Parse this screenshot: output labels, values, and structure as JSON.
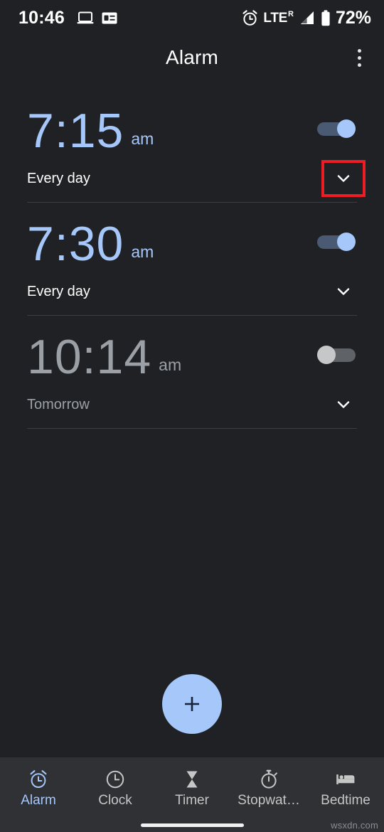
{
  "status_bar": {
    "time": "10:46",
    "left_icons": [
      "laptop-icon",
      "card-icon"
    ],
    "alarm_icon": "alarm-clock-icon",
    "network_type": "LTE",
    "network_superscript": "R",
    "signal_icon": "signal-bars-icon",
    "battery_icon": "battery-icon",
    "battery_percent": "72%"
  },
  "app_bar": {
    "title": "Alarm",
    "overflow_menu": "more-options"
  },
  "alarms": [
    {
      "time": "7:15",
      "ampm": "am",
      "schedule": "Every day",
      "enabled": true,
      "highlighted": true
    },
    {
      "time": "7:30",
      "ampm": "am",
      "schedule": "Every day",
      "enabled": true,
      "highlighted": false
    },
    {
      "time": "10:14",
      "ampm": "am",
      "schedule": "Tomorrow",
      "enabled": false,
      "highlighted": false
    }
  ],
  "fab": {
    "label": "+",
    "name": "add-alarm-button"
  },
  "bottom_nav": {
    "items": [
      {
        "label": "Alarm",
        "icon": "alarm-clock-icon",
        "active": true
      },
      {
        "label": "Clock",
        "icon": "clock-icon",
        "active": false
      },
      {
        "label": "Timer",
        "icon": "hourglass-icon",
        "active": false
      },
      {
        "label": "Stopwat…",
        "icon": "stopwatch-icon",
        "active": false
      },
      {
        "label": "Bedtime",
        "icon": "bed-icon",
        "active": false
      }
    ]
  },
  "watermark": "wsxdn.com",
  "colors": {
    "background": "#202124",
    "nav_background": "#2f3135",
    "accent_blue": "#a5c7fa",
    "muted_gray": "#9aa0a6",
    "highlight_red": "#ee1c25",
    "divider": "#3b3d40"
  }
}
